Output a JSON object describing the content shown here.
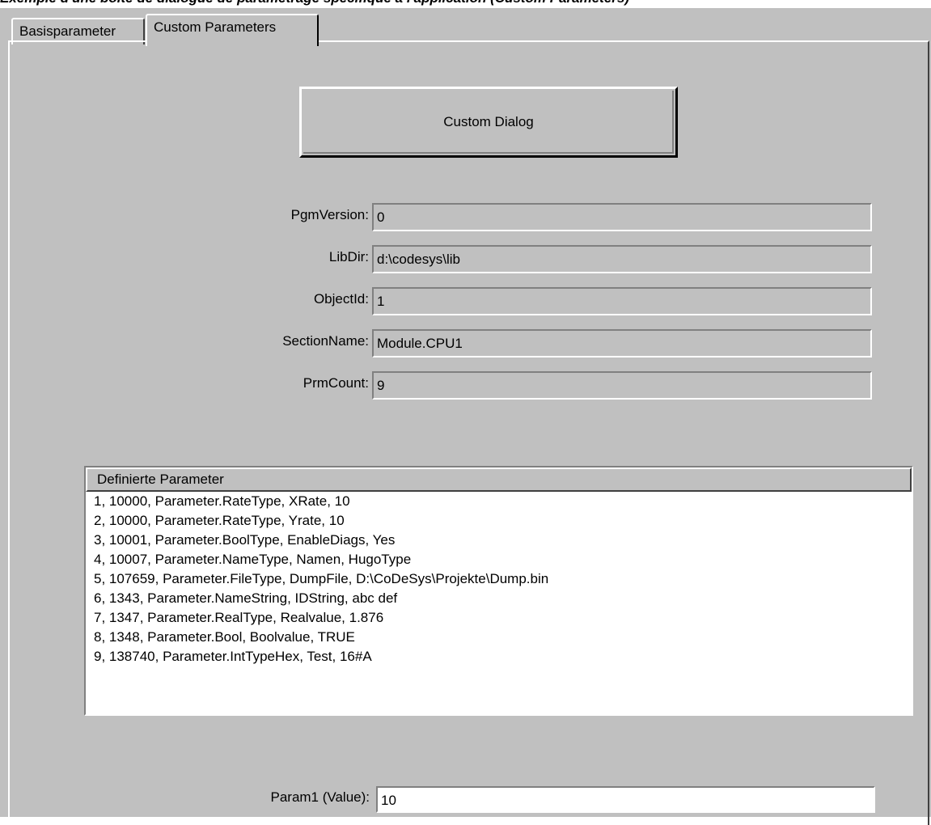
{
  "caption": "Exemple d'une boîte de dialogue de paramétrage spécifique à l'application (Custom Parameters)",
  "tabs": [
    {
      "label": "Basisparameter"
    },
    {
      "label": "Custom Parameters"
    }
  ],
  "custom_dialog_label": "Custom Dialog",
  "fields": [
    {
      "label": "PgmVersion:",
      "value": "0"
    },
    {
      "label": "LibDir:",
      "value": "d:\\codesys\\lib"
    },
    {
      "label": "ObjectId:",
      "value": "1"
    },
    {
      "label": "SectionName:",
      "value": "Module.CPU1"
    },
    {
      "label": "PrmCount:",
      "value": "9"
    }
  ],
  "list": {
    "header": "Definierte Parameter",
    "rows": [
      "1, 10000, Parameter.RateType, XRate, 10",
      "2, 10000, Parameter.RateType, Yrate, 10",
      "3, 10001, Parameter.BoolType, EnableDiags, Yes",
      "4, 10007, Parameter.NameType, Namen, HugoType",
      "5, 107659, Parameter.FileType, DumpFile, D:\\CoDeSys\\Projekte\\Dump.bin",
      "6, 1343, Parameter.NameString, IDString, abc def",
      "7, 1347, Parameter.RealType, Realvalue, 1.876",
      "8, 1348, Parameter.Bool, Boolvalue, TRUE",
      "9, 138740, Parameter.IntTypeHex, Test, 16#A"
    ]
  },
  "param1": {
    "label": "Param1 (Value):",
    "value": "10"
  }
}
